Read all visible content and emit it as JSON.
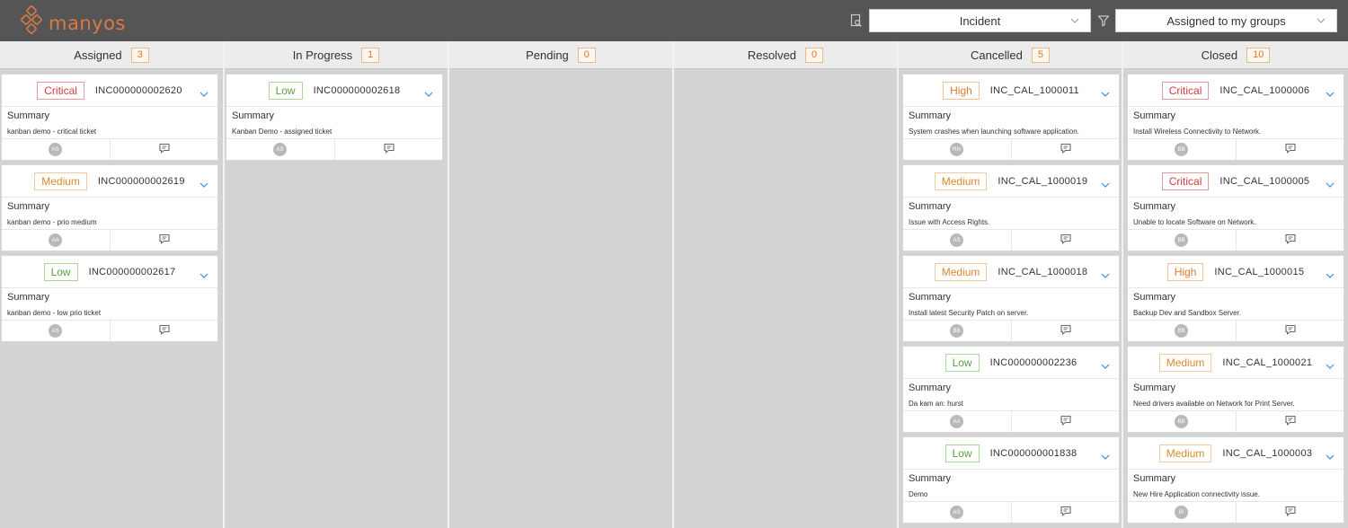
{
  "app": {
    "logo_text": "manyos",
    "brand_color": "#d97a45"
  },
  "toolbar": {
    "report_icon": "report-search-icon",
    "filter_icon": "filter-icon",
    "type_select": {
      "value": "Incident"
    },
    "group_select": {
      "value": "Assigned to my groups"
    }
  },
  "priority_colors": {
    "Critical": "#d43b3b",
    "High": "#e07b2a",
    "Medium": "#d88a2c",
    "Low": "#5aa043"
  },
  "columns": [
    {
      "title": "Assigned",
      "count": "3",
      "cards": [
        {
          "priority": "Critical",
          "id": "INC000000002620",
          "summary_label": "Summary",
          "summary": "kanban demo - critical ticket",
          "assignee": "AS"
        },
        {
          "priority": "Medium",
          "id": "INC000000002619",
          "summary_label": "Summary",
          "summary": "kanban demo - prio medium",
          "assignee": "AA"
        },
        {
          "priority": "Low",
          "id": "INC000000002617",
          "summary_label": "Summary",
          "summary": "kanban demo - low prio ticket",
          "assignee": "AS"
        }
      ]
    },
    {
      "title": "In Progress",
      "count": "1",
      "cards": [
        {
          "priority": "Low",
          "id": "INC000000002618",
          "summary_label": "Summary",
          "summary": "Kanban Demo - assigned ticket",
          "assignee": "AS"
        }
      ]
    },
    {
      "title": "Pending",
      "count": "0",
      "cards": []
    },
    {
      "title": "Resolved",
      "count": "0",
      "cards": []
    },
    {
      "title": "Cancelled",
      "count": "5",
      "cards": [
        {
          "priority": "High",
          "id": "INC_CAL_1000011",
          "summary_label": "Summary",
          "summary": "System crashes when launching software application.",
          "assignee": "RH"
        },
        {
          "priority": "Medium",
          "id": "INC_CAL_1000019",
          "summary_label": "Summary",
          "summary": "Issue with Access Rights.",
          "assignee": "AS"
        },
        {
          "priority": "Medium",
          "id": "INC_CAL_1000018",
          "summary_label": "Summary",
          "summary": "Install latest Security Patch on server.",
          "assignee": "BB"
        },
        {
          "priority": "Low",
          "id": "INC000000002236",
          "summary_label": "Summary",
          "summary": "Da kam an: hurst",
          "assignee": "AA"
        },
        {
          "priority": "Low",
          "id": "INC000000001838",
          "summary_label": "Summary",
          "summary": "Demo",
          "assignee": "AS"
        }
      ]
    },
    {
      "title": "Closed",
      "count": "10",
      "cards": [
        {
          "priority": "Critical",
          "id": "INC_CAL_1000006",
          "summary_label": "Summary",
          "summary": "Install Wireless Connectivity to Network.",
          "assignee": "BB"
        },
        {
          "priority": "Critical",
          "id": "INC_CAL_1000005",
          "summary_label": "Summary",
          "summary": "Unable to locate Software on Network.",
          "assignee": "BB"
        },
        {
          "priority": "High",
          "id": "INC_CAL_1000015",
          "summary_label": "Summary",
          "summary": "Backup Dev and Sandbox Server.",
          "assignee": "BB"
        },
        {
          "priority": "Medium",
          "id": "INC_CAL_1000021",
          "summary_label": "Summary",
          "summary": "Need drivers available on Network for Print Server.",
          "assignee": "BB"
        },
        {
          "priority": "Medium",
          "id": "INC_CAL_1000003",
          "summary_label": "Summary",
          "summary": "New Hire Application connectivity issue.",
          "assignee": "IP"
        }
      ]
    }
  ]
}
